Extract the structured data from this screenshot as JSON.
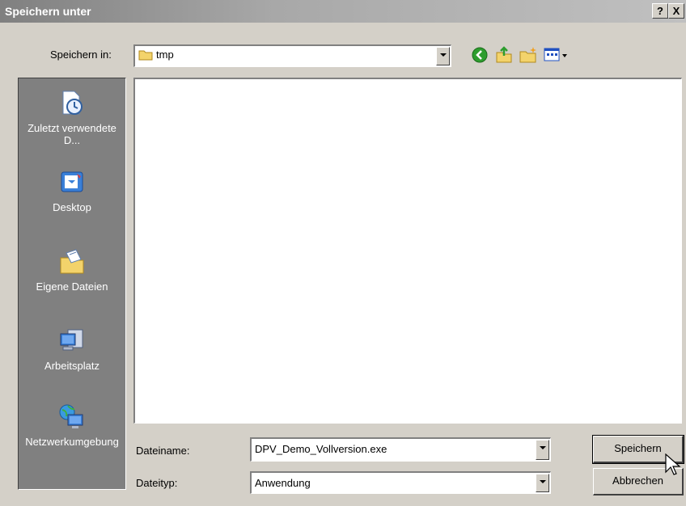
{
  "window": {
    "title": "Speichern unter",
    "help_label": "?",
    "close_label": "X"
  },
  "save_in": {
    "label": "Speichern in:",
    "value": "tmp"
  },
  "toolbar": {
    "icons": [
      "back-icon",
      "up-folder-icon",
      "new-folder-icon",
      "view-menu-icon"
    ]
  },
  "places": [
    {
      "label": "Zuletzt verwendete D...",
      "icon": "recent-documents-icon"
    },
    {
      "label": "Desktop",
      "icon": "desktop-icon"
    },
    {
      "label": "Eigene Dateien",
      "icon": "my-documents-icon"
    },
    {
      "label": "Arbeitsplatz",
      "icon": "my-computer-icon"
    },
    {
      "label": "Netzwerkumgebung",
      "icon": "network-icon"
    }
  ],
  "filename": {
    "label": "Dateiname:",
    "value": "DPV_Demo_Vollversion.exe"
  },
  "filetype": {
    "label": "Dateityp:",
    "value": "Anwendung"
  },
  "buttons": {
    "save": "Speichern",
    "cancel": "Abbrechen"
  }
}
